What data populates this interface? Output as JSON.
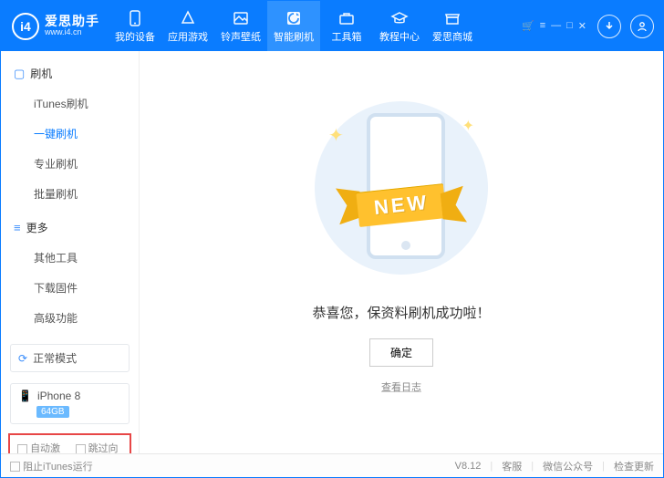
{
  "app": {
    "name": "爱思助手",
    "url": "www.i4.cn",
    "logo_text": "i4"
  },
  "titlebar_icons": {
    "cart": "🛒",
    "menu": "≡",
    "min": "—",
    "max": "□",
    "close": "✕"
  },
  "topnav": [
    {
      "label": "我的设备"
    },
    {
      "label": "应用游戏"
    },
    {
      "label": "铃声壁纸"
    },
    {
      "label": "智能刷机"
    },
    {
      "label": "工具箱"
    },
    {
      "label": "教程中心"
    },
    {
      "label": "爱思商城"
    }
  ],
  "sidebar": {
    "sec1": {
      "title": "刷机"
    },
    "flash_items": [
      {
        "label": "iTunes刷机"
      },
      {
        "label": "一键刷机"
      },
      {
        "label": "专业刷机"
      },
      {
        "label": "批量刷机"
      }
    ],
    "sec2": {
      "title": "更多"
    },
    "more_items": [
      {
        "label": "其他工具"
      },
      {
        "label": "下载固件"
      },
      {
        "label": "高级功能"
      }
    ],
    "mode_box": "正常模式",
    "device": {
      "name": "iPhone 8",
      "storage": "64GB"
    },
    "checks": {
      "auto_activate": "自动激活",
      "skip_guide": "跳过向导"
    }
  },
  "main": {
    "ribbon": "NEW",
    "success": "恭喜您，保资料刷机成功啦！",
    "confirm": "确定",
    "view_log": "查看日志"
  },
  "statusbar": {
    "block_itunes": "阻止iTunes运行",
    "version": "V8.12",
    "svc": "客服",
    "wechat": "微信公众号",
    "update": "检查更新"
  }
}
